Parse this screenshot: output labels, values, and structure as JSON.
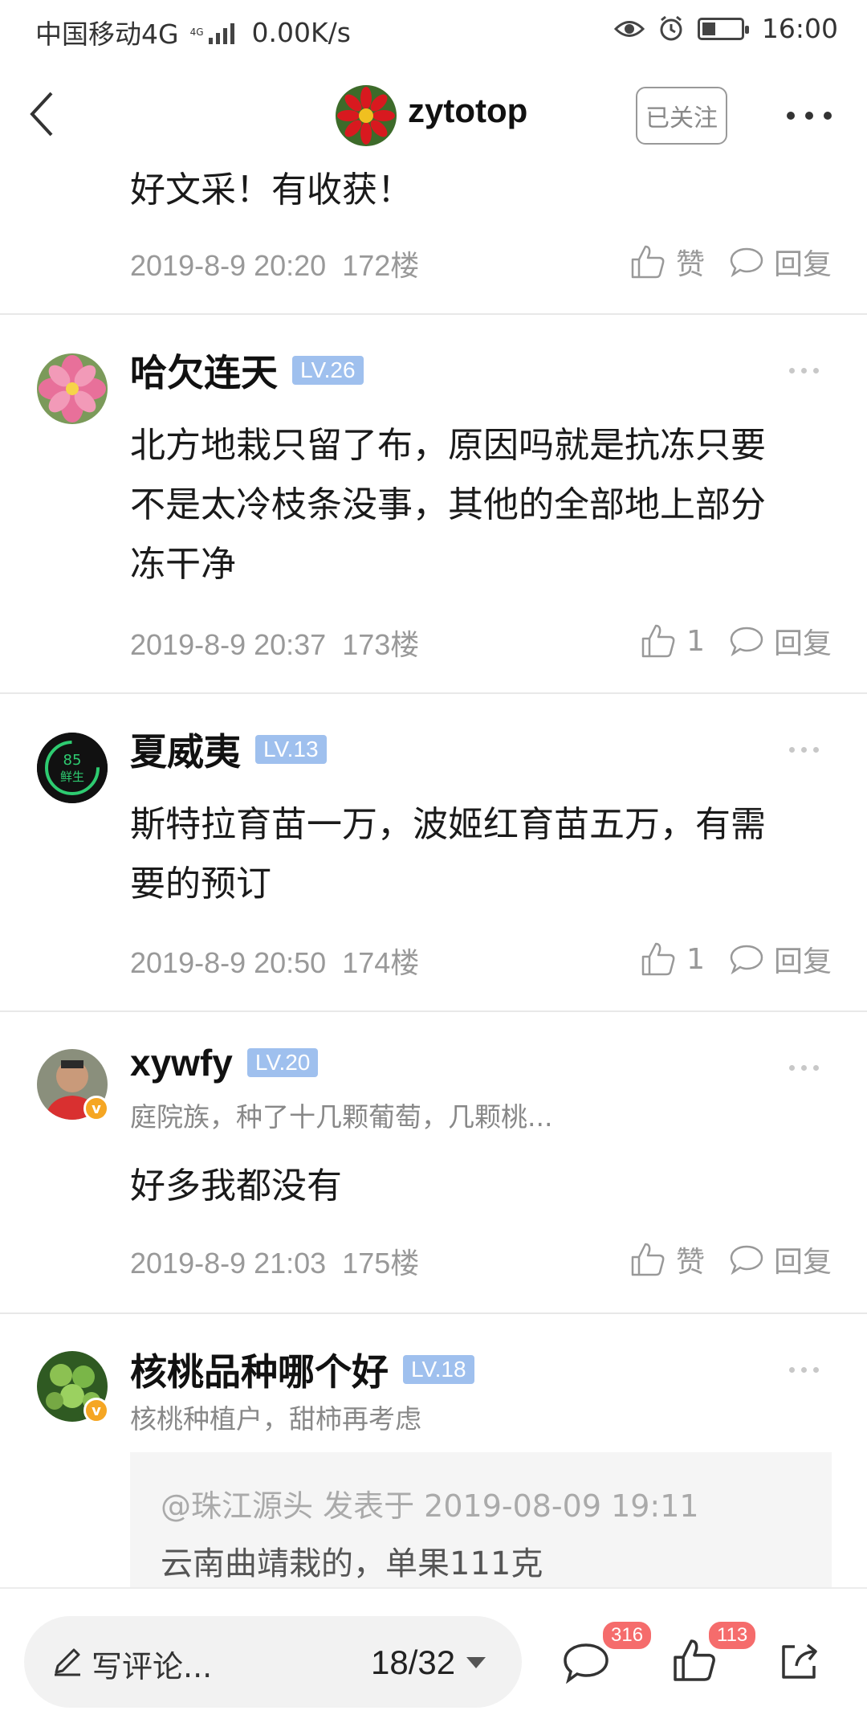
{
  "status_bar": {
    "carrier": "中国移动4G",
    "net_type": "4G",
    "speed": "0.00K/s",
    "time": "16:00",
    "icons": [
      "eye-icon",
      "alarm-icon",
      "battery-icon"
    ]
  },
  "header": {
    "back_icon": "back-arrow-icon",
    "author_name": "zytotop",
    "follow_label": "已关注",
    "more_icon": "more-dots-icon"
  },
  "comments": [
    {
      "text": "好文采！有收获！",
      "date": "2019-8-9 20:20",
      "floor": "172楼",
      "like_label": "赞",
      "reply_label": "回复"
    },
    {
      "user": "哈欠连天",
      "level": "LV.26",
      "text_lines": [
        "北方地栽只留了布，原因吗就是抗冻只要",
        "不是太冷枝条没事，其他的全部地上部分",
        "冻干净"
      ],
      "date": "2019-8-9 20:37",
      "floor": "173楼",
      "like_count": "1",
      "reply_label": "回复"
    },
    {
      "user": "夏威夷",
      "level": "LV.13",
      "avatar_text": "85 鲜生",
      "text_lines": [
        "斯特拉育苗一万，波姬红育苗五万，有需",
        "要的预订"
      ],
      "date": "2019-8-9 20:50",
      "floor": "174楼",
      "like_count": "1",
      "reply_label": "回复"
    },
    {
      "user": "xywfy",
      "level": "LV.20",
      "desc": "庭院族，种了十几颗葡萄，几颗桃...",
      "text": "好多我都没有",
      "date": "2019-8-9 21:03",
      "floor": "175楼",
      "like_label": "赞",
      "reply_label": "回复"
    },
    {
      "user": "核桃品种哪个好",
      "level": "LV.18",
      "desc": "核桃种植户，甜柿再考虑",
      "quote_head": "@珠江源头 发表于 2019-08-09 19:11",
      "quote_text": "云南曲靖栽的，单果111克"
    }
  ],
  "bottom_bar": {
    "placeholder": "写评论...",
    "page_indicator": "18/32",
    "comment_badge": "316",
    "like_badge": "113",
    "icons": [
      "pen-icon",
      "comment-icon",
      "thumb-up-icon",
      "share-icon"
    ]
  }
}
